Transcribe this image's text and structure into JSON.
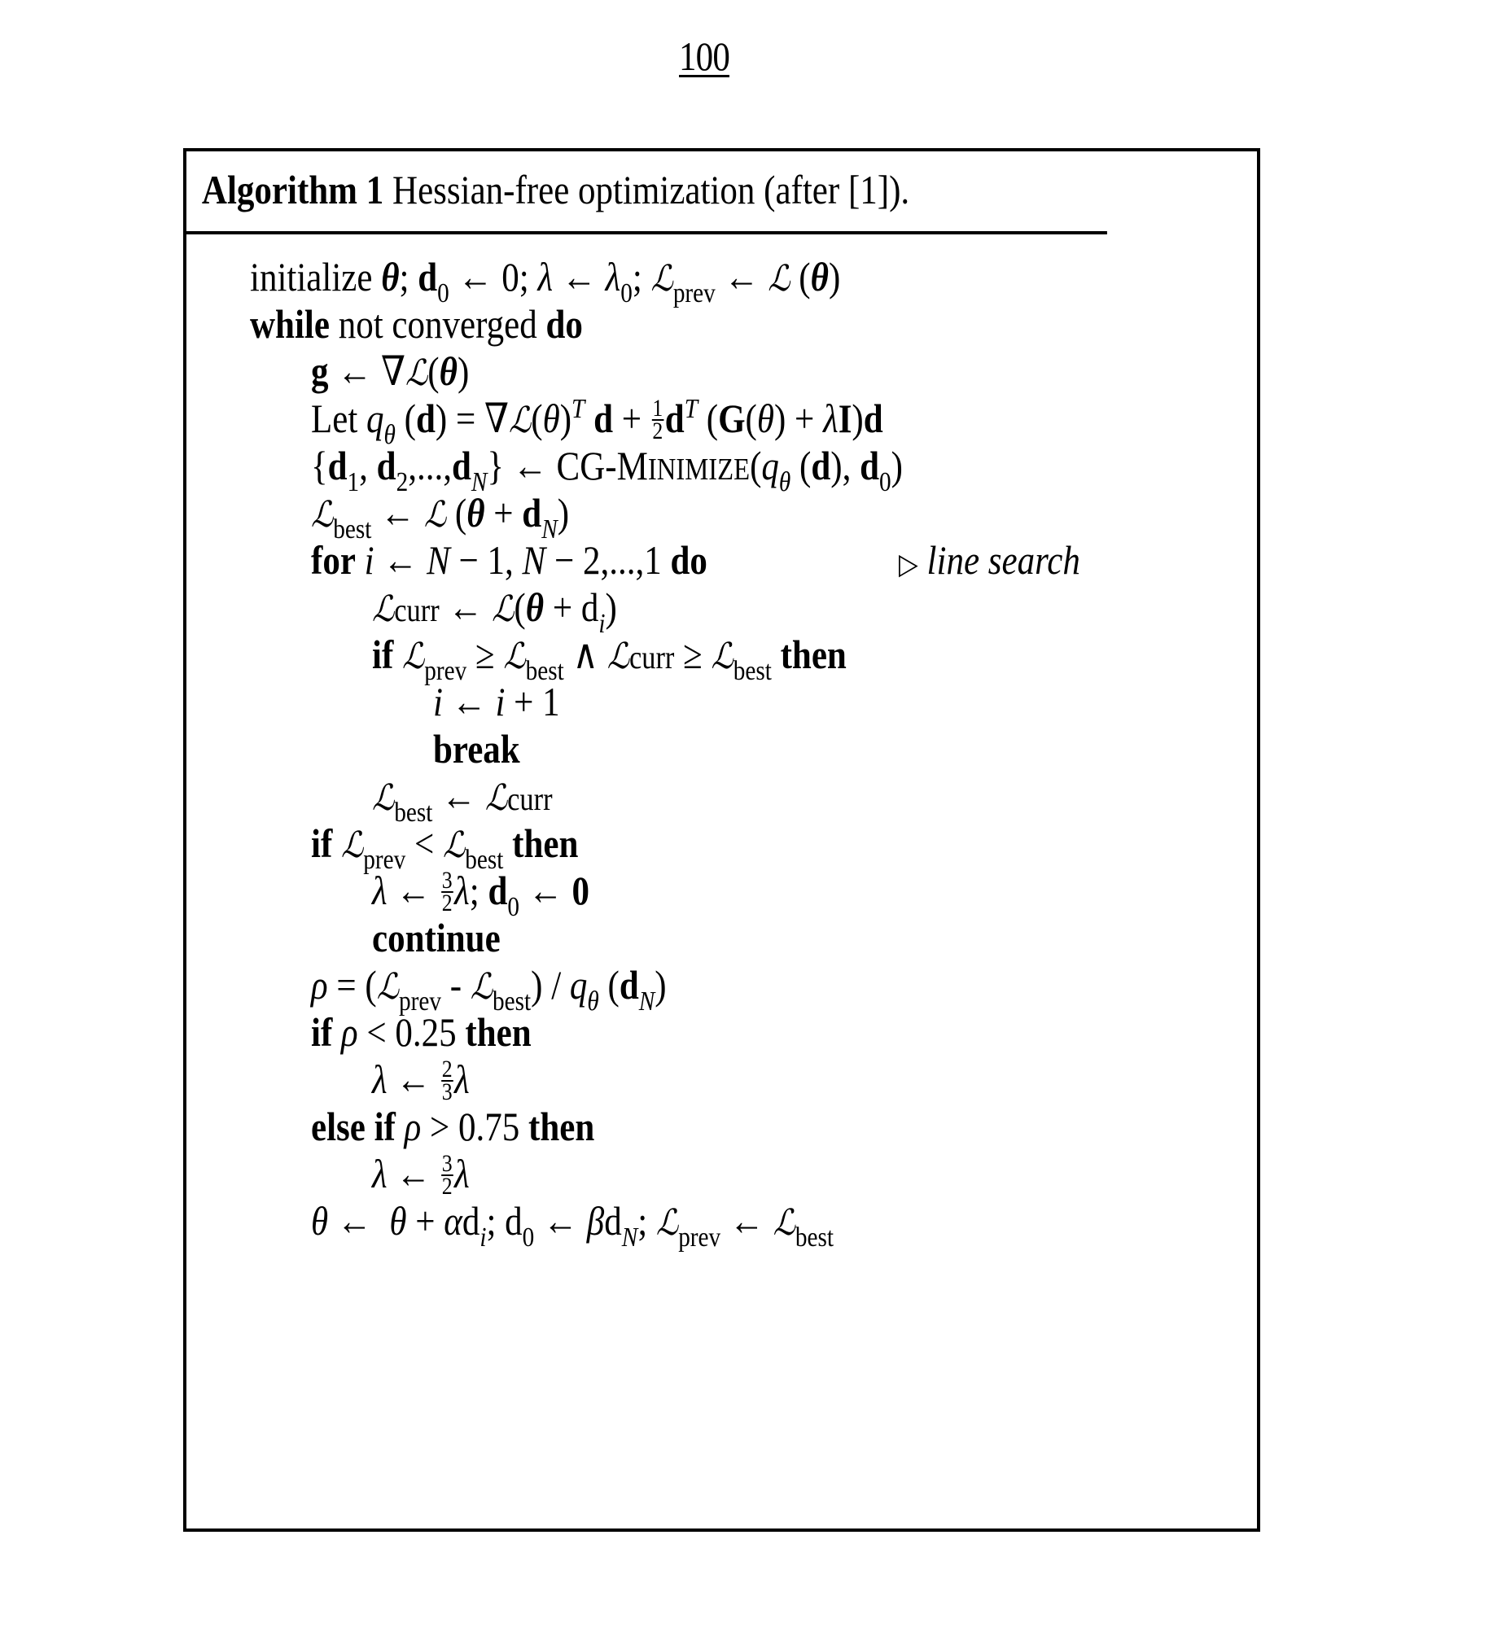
{
  "figure_label": "100",
  "algorithm": {
    "header": {
      "label": "Algorithm 1",
      "title": "Hessian-free optimization (after [1])."
    },
    "lines": [
      {
        "indent": 0,
        "text": "initialize θ; d₀ ← 0; λ ← λ₀; ℒprev ← ℒ(θ)"
      },
      {
        "indent": 0,
        "text": "while not converged do"
      },
      {
        "indent": 1,
        "text": "g ← ∇ℒ(θ)"
      },
      {
        "indent": 1,
        "text": "Let qθ(d) = ∇ℒ(θ)ᵀ d + ½ dᵀ (G(θ) + λI)d"
      },
      {
        "indent": 1,
        "text": "{d₁, d₂,...,d_N} ← CG-MINIMIZE(qθ(d), d₀)"
      },
      {
        "indent": 1,
        "text": "ℒbest ← ℒ(θ + d_N)"
      },
      {
        "indent": 1,
        "text": "for i ← N − 1, N − 2,...,1 do",
        "comment": "line search"
      },
      {
        "indent": 2,
        "text": "ℒcurr ← ℒ(θ + d_i)"
      },
      {
        "indent": 2,
        "text": "if ℒprev ≥ ℒbest ∧ ℒcurr ≥ ℒbest then"
      },
      {
        "indent": 3,
        "text": "i ← i + 1"
      },
      {
        "indent": 3,
        "text": "break"
      },
      {
        "indent": 2,
        "text": "ℒbest ← ℒcurr"
      },
      {
        "indent": 1,
        "text": "if ℒprev < ℒbest then"
      },
      {
        "indent": 2,
        "text": "λ ← 3/2 λ; d₀ ← 0"
      },
      {
        "indent": 2,
        "text": "continue"
      },
      {
        "indent": 1,
        "text": "ρ = (ℒprev - ℒbest) / qθ(d_N)"
      },
      {
        "indent": 1,
        "text": "if ρ < 0.25 then"
      },
      {
        "indent": 2,
        "text": "λ ← 2/3 λ"
      },
      {
        "indent": 1,
        "text": "else if ρ > 0.75 then"
      },
      {
        "indent": 2,
        "text": "λ ← 3/2 λ"
      },
      {
        "indent": 1,
        "text": "θ ← θ + αd_i; d₀ ← βd_N; ℒprev ← ℒbest"
      }
    ],
    "tokens": {
      "kw_while": "while",
      "kw_do": "do",
      "kw_for": "for",
      "kw_if": "if",
      "kw_then": "then",
      "kw_else_if": "else if",
      "kw_break": "break",
      "kw_continue": "continue",
      "kw_let": "Let",
      "initialize": "initialize",
      "not_converged": "not converged",
      "cg_prefix": "CG-M",
      "cg_rest": "INIMIZE",
      "comment_marker": "▷",
      "comment_text": "line search",
      "sub_prev": "prev",
      "sub_best": "best",
      "sub_curr": "curr",
      "rho_low": "0.25",
      "rho_high": "0.75"
    }
  }
}
